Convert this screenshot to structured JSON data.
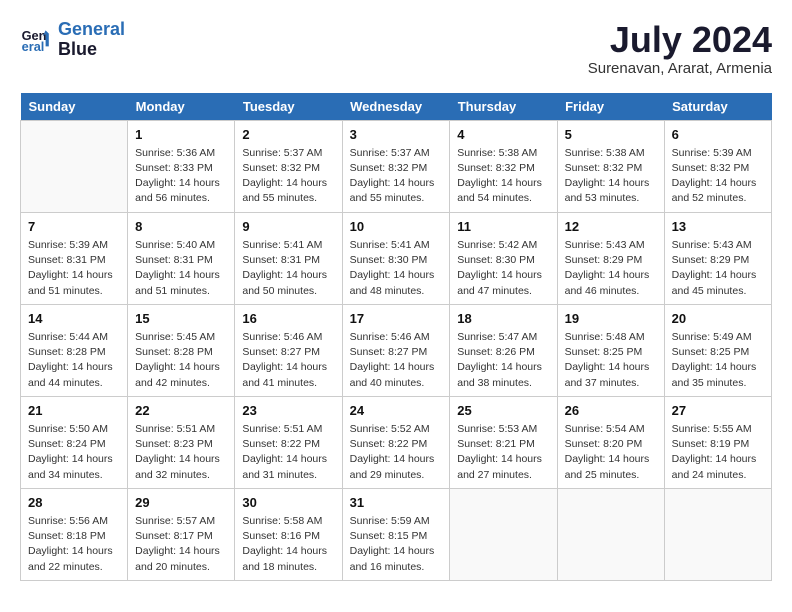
{
  "header": {
    "logo_line1": "General",
    "logo_line2": "Blue",
    "month_title": "July 2024",
    "location": "Surenavan, Ararat, Armenia"
  },
  "days_of_week": [
    "Sunday",
    "Monday",
    "Tuesday",
    "Wednesday",
    "Thursday",
    "Friday",
    "Saturday"
  ],
  "weeks": [
    [
      {
        "day": "",
        "info": ""
      },
      {
        "day": "1",
        "info": "Sunrise: 5:36 AM\nSunset: 8:33 PM\nDaylight: 14 hours\nand 56 minutes."
      },
      {
        "day": "2",
        "info": "Sunrise: 5:37 AM\nSunset: 8:32 PM\nDaylight: 14 hours\nand 55 minutes."
      },
      {
        "day": "3",
        "info": "Sunrise: 5:37 AM\nSunset: 8:32 PM\nDaylight: 14 hours\nand 55 minutes."
      },
      {
        "day": "4",
        "info": "Sunrise: 5:38 AM\nSunset: 8:32 PM\nDaylight: 14 hours\nand 54 minutes."
      },
      {
        "day": "5",
        "info": "Sunrise: 5:38 AM\nSunset: 8:32 PM\nDaylight: 14 hours\nand 53 minutes."
      },
      {
        "day": "6",
        "info": "Sunrise: 5:39 AM\nSunset: 8:32 PM\nDaylight: 14 hours\nand 52 minutes."
      }
    ],
    [
      {
        "day": "7",
        "info": "Sunrise: 5:39 AM\nSunset: 8:31 PM\nDaylight: 14 hours\nand 51 minutes."
      },
      {
        "day": "8",
        "info": "Sunrise: 5:40 AM\nSunset: 8:31 PM\nDaylight: 14 hours\nand 51 minutes."
      },
      {
        "day": "9",
        "info": "Sunrise: 5:41 AM\nSunset: 8:31 PM\nDaylight: 14 hours\nand 50 minutes."
      },
      {
        "day": "10",
        "info": "Sunrise: 5:41 AM\nSunset: 8:30 PM\nDaylight: 14 hours\nand 48 minutes."
      },
      {
        "day": "11",
        "info": "Sunrise: 5:42 AM\nSunset: 8:30 PM\nDaylight: 14 hours\nand 47 minutes."
      },
      {
        "day": "12",
        "info": "Sunrise: 5:43 AM\nSunset: 8:29 PM\nDaylight: 14 hours\nand 46 minutes."
      },
      {
        "day": "13",
        "info": "Sunrise: 5:43 AM\nSunset: 8:29 PM\nDaylight: 14 hours\nand 45 minutes."
      }
    ],
    [
      {
        "day": "14",
        "info": "Sunrise: 5:44 AM\nSunset: 8:28 PM\nDaylight: 14 hours\nand 44 minutes."
      },
      {
        "day": "15",
        "info": "Sunrise: 5:45 AM\nSunset: 8:28 PM\nDaylight: 14 hours\nand 42 minutes."
      },
      {
        "day": "16",
        "info": "Sunrise: 5:46 AM\nSunset: 8:27 PM\nDaylight: 14 hours\nand 41 minutes."
      },
      {
        "day": "17",
        "info": "Sunrise: 5:46 AM\nSunset: 8:27 PM\nDaylight: 14 hours\nand 40 minutes."
      },
      {
        "day": "18",
        "info": "Sunrise: 5:47 AM\nSunset: 8:26 PM\nDaylight: 14 hours\nand 38 minutes."
      },
      {
        "day": "19",
        "info": "Sunrise: 5:48 AM\nSunset: 8:25 PM\nDaylight: 14 hours\nand 37 minutes."
      },
      {
        "day": "20",
        "info": "Sunrise: 5:49 AM\nSunset: 8:25 PM\nDaylight: 14 hours\nand 35 minutes."
      }
    ],
    [
      {
        "day": "21",
        "info": "Sunrise: 5:50 AM\nSunset: 8:24 PM\nDaylight: 14 hours\nand 34 minutes."
      },
      {
        "day": "22",
        "info": "Sunrise: 5:51 AM\nSunset: 8:23 PM\nDaylight: 14 hours\nand 32 minutes."
      },
      {
        "day": "23",
        "info": "Sunrise: 5:51 AM\nSunset: 8:22 PM\nDaylight: 14 hours\nand 31 minutes."
      },
      {
        "day": "24",
        "info": "Sunrise: 5:52 AM\nSunset: 8:22 PM\nDaylight: 14 hours\nand 29 minutes."
      },
      {
        "day": "25",
        "info": "Sunrise: 5:53 AM\nSunset: 8:21 PM\nDaylight: 14 hours\nand 27 minutes."
      },
      {
        "day": "26",
        "info": "Sunrise: 5:54 AM\nSunset: 8:20 PM\nDaylight: 14 hours\nand 25 minutes."
      },
      {
        "day": "27",
        "info": "Sunrise: 5:55 AM\nSunset: 8:19 PM\nDaylight: 14 hours\nand 24 minutes."
      }
    ],
    [
      {
        "day": "28",
        "info": "Sunrise: 5:56 AM\nSunset: 8:18 PM\nDaylight: 14 hours\nand 22 minutes."
      },
      {
        "day": "29",
        "info": "Sunrise: 5:57 AM\nSunset: 8:17 PM\nDaylight: 14 hours\nand 20 minutes."
      },
      {
        "day": "30",
        "info": "Sunrise: 5:58 AM\nSunset: 8:16 PM\nDaylight: 14 hours\nand 18 minutes."
      },
      {
        "day": "31",
        "info": "Sunrise: 5:59 AM\nSunset: 8:15 PM\nDaylight: 14 hours\nand 16 minutes."
      },
      {
        "day": "",
        "info": ""
      },
      {
        "day": "",
        "info": ""
      },
      {
        "day": "",
        "info": ""
      }
    ]
  ]
}
